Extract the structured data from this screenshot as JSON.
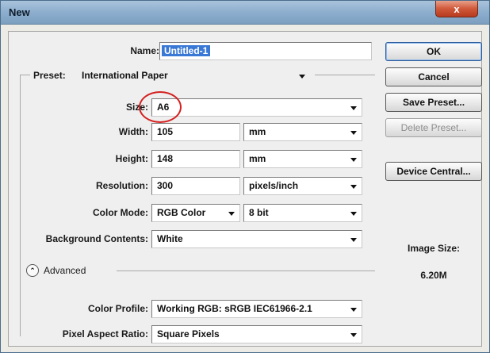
{
  "window": {
    "title": "New",
    "close_glyph": "x"
  },
  "form": {
    "name_label": "Name:",
    "name_value": "Untitled-1",
    "preset_label": "Preset:",
    "preset_value": "International Paper",
    "size_label": "Size:",
    "size_value": "A6",
    "width_label": "Width:",
    "width_value": "105",
    "width_unit": "mm",
    "height_label": "Height:",
    "height_value": "148",
    "height_unit": "mm",
    "resolution_label": "Resolution:",
    "resolution_value": "300",
    "resolution_unit": "pixels/inch",
    "color_mode_label": "Color Mode:",
    "color_mode_value": "RGB Color",
    "bit_depth_value": "8 bit",
    "background_label": "Background Contents:",
    "background_value": "White",
    "advanced_label": "Advanced",
    "advanced_glyph": "⌃",
    "color_profile_label": "Color Profile:",
    "color_profile_value": "Working RGB:  sRGB IEC61966-2.1",
    "pixel_aspect_label": "Pixel Aspect Ratio:",
    "pixel_aspect_value": "Square Pixels"
  },
  "buttons": {
    "ok": "OK",
    "cancel": "Cancel",
    "save_preset": "Save Preset...",
    "delete_preset": "Delete Preset...",
    "device_central": "Device Central..."
  },
  "info": {
    "image_size_label": "Image Size:",
    "image_size_value": "6.20M"
  },
  "colors": {
    "highlight": "#d42020",
    "selection": "#3a78d6"
  }
}
